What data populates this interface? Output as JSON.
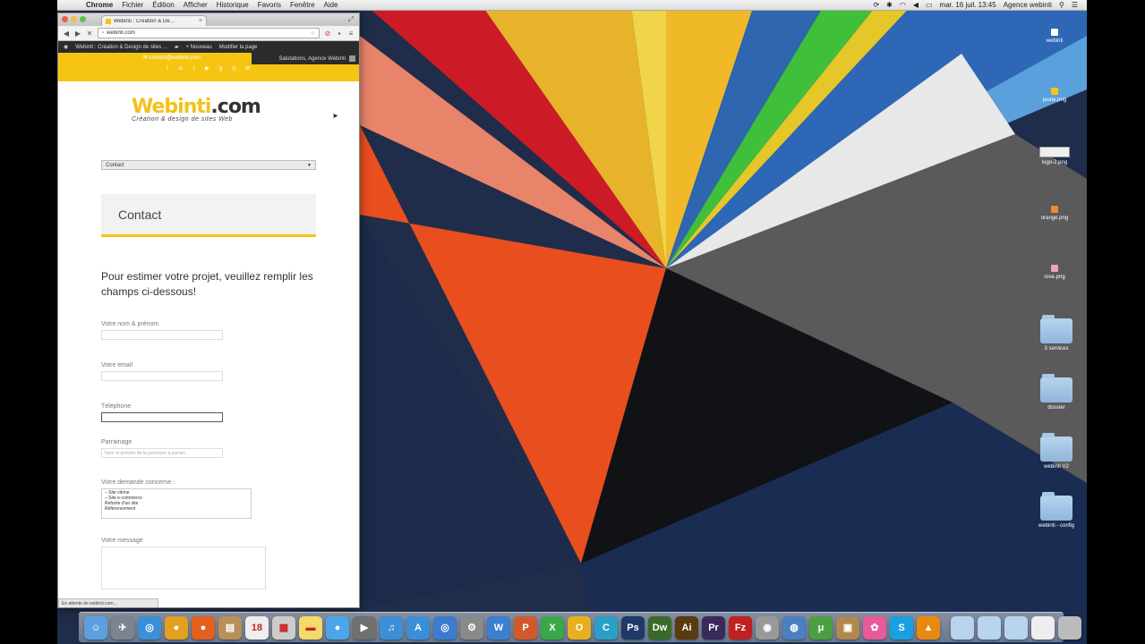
{
  "menubar": {
    "app_name": "Chrome",
    "items": [
      "Fichier",
      "Édition",
      "Afficher",
      "Historique",
      "Favoris",
      "Fenêtre",
      "Aide"
    ],
    "datetime": "mar. 16 juil. 13:45",
    "user": "Agence webinti"
  },
  "browser": {
    "tab_title": "Webinti : Création & Dé…",
    "url": "webinti.com",
    "status_text": "En attente de webinti.com..."
  },
  "adminbar": {
    "site": "Webinti : Création & Design de sites ...",
    "new_label": "Nouveau",
    "edit_label": "Modifier la page",
    "greeting": "Salutations, Agence Webinti"
  },
  "site": {
    "header_email": "contact@webinti.com",
    "logo_main": "Webinti",
    "logo_dot": ".com",
    "logo_tagline": "Création & design de sites Web",
    "nav_selected": "Contact",
    "contact_title": "Contact",
    "intro": "Pour estimer votre projet, veuillez remplir les champs ci-dessous!",
    "fields": {
      "name_label": "Votre nom & prénom",
      "email_label": "Votre email",
      "phone_label": "Téléphone",
      "sponsor_label": "Parrainage",
      "sponsor_placeholder": "Nom et prénom de la personne à parrain",
      "demand_label": "Votre demande concerne :",
      "demand_options": [
        "– Site vitrine",
        "– Site e-commerce",
        "Refonte d'un site",
        "Référencement"
      ],
      "message_label": "Votre message"
    }
  },
  "desktop_icons": [
    {
      "label": "webinti",
      "kind": "file"
    },
    {
      "label": "jaune.png",
      "kind": "file"
    },
    {
      "label": "logo-2.png",
      "kind": "wide"
    },
    {
      "label": "orange.png",
      "kind": "file"
    },
    {
      "label": "rose.png",
      "kind": "file"
    },
    {
      "label": "3 services",
      "kind": "folder"
    },
    {
      "label": "dossier",
      "kind": "folder"
    },
    {
      "label": "webinti V2",
      "kind": "folder"
    },
    {
      "label": "webinti - config",
      "kind": "folder"
    }
  ],
  "dock_apps": [
    {
      "name": "Finder",
      "glyph": "☺",
      "color": "#5aa0e0"
    },
    {
      "name": "Launchpad",
      "glyph": "✈",
      "color": "#7a8590"
    },
    {
      "name": "Safari",
      "glyph": "◎",
      "color": "#3b8fd8"
    },
    {
      "name": "Chrome",
      "glyph": "●",
      "color": "#e0a020"
    },
    {
      "name": "Firefox",
      "glyph": "●",
      "color": "#e4601f"
    },
    {
      "name": "Contacts",
      "glyph": "▤",
      "color": "#b89058"
    },
    {
      "name": "Calendar",
      "glyph": "18",
      "color": "#eeeeee"
    },
    {
      "name": "Preview",
      "glyph": "▦",
      "color": "#cccccc"
    },
    {
      "name": "Notes",
      "glyph": "▬",
      "color": "#f4d96b"
    },
    {
      "name": "Messages",
      "glyph": "●",
      "color": "#4aa6e8"
    },
    {
      "name": "FaceTime",
      "glyph": "▶",
      "color": "#707070"
    },
    {
      "name": "iTunes",
      "glyph": "♫",
      "color": "#3a8fd8"
    },
    {
      "name": "App Store",
      "glyph": "A",
      "color": "#3a8fd8"
    },
    {
      "name": "Maps",
      "glyph": "◎",
      "color": "#3c7bd0"
    },
    {
      "name": "System Preferences",
      "glyph": "⚙",
      "color": "#8a8a8a"
    },
    {
      "name": "Word",
      "glyph": "W",
      "color": "#3b7fd1"
    },
    {
      "name": "PowerPoint",
      "glyph": "P",
      "color": "#d05a2a"
    },
    {
      "name": "Excel",
      "glyph": "X",
      "color": "#3aa84a"
    },
    {
      "name": "Outlook",
      "glyph": "O",
      "color": "#e8b020"
    },
    {
      "name": "Lync",
      "glyph": "C",
      "color": "#2aa0c8"
    },
    {
      "name": "Photoshop",
      "glyph": "Ps",
      "color": "#1e3a66"
    },
    {
      "name": "Dreamweaver",
      "glyph": "Dw",
      "color": "#3a6a2a"
    },
    {
      "name": "Illustrator",
      "glyph": "Ai",
      "color": "#5a3a10"
    },
    {
      "name": "Premiere",
      "glyph": "Pr",
      "color": "#3a2a5a"
    },
    {
      "name": "FileZilla",
      "glyph": "Fz",
      "color": "#c02020"
    },
    {
      "name": "Disk Utility",
      "glyph": "◉",
      "color": "#999999"
    },
    {
      "name": "Network",
      "glyph": "◍",
      "color": "#4a80c0"
    },
    {
      "name": "uTorrent",
      "glyph": "μ",
      "color": "#4aa040"
    },
    {
      "name": "Archive",
      "glyph": "▣",
      "color": "#b08850"
    },
    {
      "name": "Picasa",
      "glyph": "✿",
      "color": "#e85a9a"
    },
    {
      "name": "Skype",
      "glyph": "S",
      "color": "#1aa0e0"
    },
    {
      "name": "VLC",
      "glyph": "▲",
      "color": "#e88a10"
    }
  ],
  "dock_stacks": [
    {
      "name": "Applications stack",
      "color": "#b8d4ee"
    },
    {
      "name": "Documents stack",
      "color": "#b8d4ee"
    },
    {
      "name": "Downloads stack",
      "color": "#b8d4ee"
    },
    {
      "name": "Screenshot stack",
      "color": "#eeeeee"
    },
    {
      "name": "Trash",
      "color": "#bbbbbb"
    }
  ],
  "colors": {
    "brand_yellow": "#f6c512",
    "admin_dark": "#2b2b2b"
  }
}
